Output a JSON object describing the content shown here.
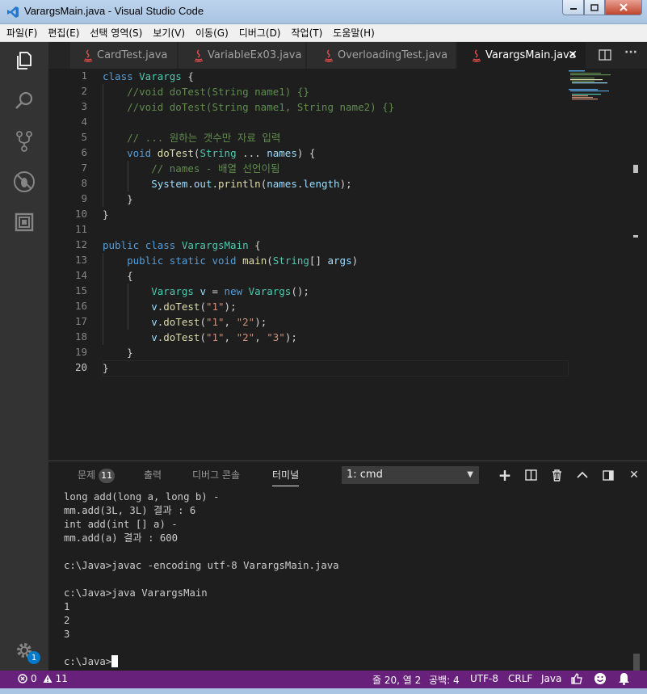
{
  "window": {
    "title": "VarargsMain.java - Visual Studio Code"
  },
  "menu": [
    "파일(F)",
    "편집(E)",
    "선택 영역(S)",
    "보기(V)",
    "이동(G)",
    "디버그(D)",
    "작업(T)",
    "도움말(H)"
  ],
  "activity_bar": {
    "icons": [
      "files-icon",
      "search-icon",
      "source-control-icon",
      "debug-icon",
      "extensions-icon"
    ],
    "settings_badge": "1"
  },
  "tabs": [
    {
      "label": "CardTest.java",
      "active": false
    },
    {
      "label": "VariableEx03.java",
      "active": false
    },
    {
      "label": "OverloadingTest.java",
      "active": false
    },
    {
      "label": "VarargsMain.java",
      "active": true
    }
  ],
  "tab_close_glyph": "✕",
  "tab_actions": {
    "more": "···"
  },
  "editor": {
    "line_numbers": [
      "1",
      "2",
      "3",
      "4",
      "5",
      "6",
      "7",
      "8",
      "9",
      "10",
      "11",
      "12",
      "13",
      "14",
      "15",
      "16",
      "17",
      "18",
      "19",
      "20"
    ],
    "current_line": "20",
    "lines": [
      [
        {
          "t": "class ",
          "c": "kw"
        },
        {
          "t": "Varargs",
          "c": "ty"
        },
        {
          "t": " {",
          "c": "pl"
        }
      ],
      [
        {
          "t": "    //void doTest(String name1) {}",
          "c": "cm"
        }
      ],
      [
        {
          "t": "    //void doTest(String name1, String name2) {}",
          "c": "cm"
        }
      ],
      [],
      [
        {
          "t": "    // ... 원하는 갯수만 자료 입력",
          "c": "cm"
        }
      ],
      [
        {
          "t": "    ",
          "c": "pl"
        },
        {
          "t": "void ",
          "c": "kw"
        },
        {
          "t": "doTest",
          "c": "fn"
        },
        {
          "t": "(",
          "c": "pl"
        },
        {
          "t": "String",
          "c": "ty"
        },
        {
          "t": " ... ",
          "c": "pl"
        },
        {
          "t": "names",
          "c": "vr"
        },
        {
          "t": ") {",
          "c": "pl"
        }
      ],
      [
        {
          "t": "        // names - 배열 선언이됨",
          "c": "cm"
        }
      ],
      [
        {
          "t": "        ",
          "c": "pl"
        },
        {
          "t": "System",
          "c": "vr"
        },
        {
          "t": ".",
          "c": "pl"
        },
        {
          "t": "out",
          "c": "vr"
        },
        {
          "t": ".",
          "c": "pl"
        },
        {
          "t": "println",
          "c": "fn"
        },
        {
          "t": "(",
          "c": "pl"
        },
        {
          "t": "names",
          "c": "vr"
        },
        {
          "t": ".",
          "c": "pl"
        },
        {
          "t": "length",
          "c": "vr"
        },
        {
          "t": ");",
          "c": "pl"
        }
      ],
      [
        {
          "t": "    }",
          "c": "pl"
        }
      ],
      [
        {
          "t": "}",
          "c": "pl"
        }
      ],
      [],
      [
        {
          "t": "public ",
          "c": "kw"
        },
        {
          "t": "class ",
          "c": "kw"
        },
        {
          "t": "VarargsMain",
          "c": "ty"
        },
        {
          "t": " {",
          "c": "pl"
        }
      ],
      [
        {
          "t": "    ",
          "c": "pl"
        },
        {
          "t": "public ",
          "c": "kw"
        },
        {
          "t": "static ",
          "c": "kw"
        },
        {
          "t": "void ",
          "c": "kw"
        },
        {
          "t": "main",
          "c": "fn"
        },
        {
          "t": "(",
          "c": "pl"
        },
        {
          "t": "String",
          "c": "ty"
        },
        {
          "t": "[] ",
          "c": "pl"
        },
        {
          "t": "args",
          "c": "vr"
        },
        {
          "t": ")",
          "c": "pl"
        }
      ],
      [
        {
          "t": "    {",
          "c": "pl"
        }
      ],
      [
        {
          "t": "        ",
          "c": "pl"
        },
        {
          "t": "Varargs",
          "c": "ty"
        },
        {
          "t": " ",
          "c": "pl"
        },
        {
          "t": "v",
          "c": "vr"
        },
        {
          "t": " = ",
          "c": "pl"
        },
        {
          "t": "new ",
          "c": "kw"
        },
        {
          "t": "Varargs",
          "c": "ty"
        },
        {
          "t": "();",
          "c": "pl"
        }
      ],
      [
        {
          "t": "        ",
          "c": "pl"
        },
        {
          "t": "v",
          "c": "vr"
        },
        {
          "t": ".",
          "c": "pl"
        },
        {
          "t": "doTest",
          "c": "fn"
        },
        {
          "t": "(",
          "c": "pl"
        },
        {
          "t": "\"1\"",
          "c": "st"
        },
        {
          "t": ");",
          "c": "pl"
        }
      ],
      [
        {
          "t": "        ",
          "c": "pl"
        },
        {
          "t": "v",
          "c": "vr"
        },
        {
          "t": ".",
          "c": "pl"
        },
        {
          "t": "doTest",
          "c": "fn"
        },
        {
          "t": "(",
          "c": "pl"
        },
        {
          "t": "\"1\"",
          "c": "st"
        },
        {
          "t": ", ",
          "c": "pl"
        },
        {
          "t": "\"2\"",
          "c": "st"
        },
        {
          "t": ");",
          "c": "pl"
        }
      ],
      [
        {
          "t": "        ",
          "c": "pl"
        },
        {
          "t": "v",
          "c": "vr"
        },
        {
          "t": ".",
          "c": "pl"
        },
        {
          "t": "doTest",
          "c": "fn"
        },
        {
          "t": "(",
          "c": "pl"
        },
        {
          "t": "\"1\"",
          "c": "st"
        },
        {
          "t": ", ",
          "c": "pl"
        },
        {
          "t": "\"2\"",
          "c": "st"
        },
        {
          "t": ", ",
          "c": "pl"
        },
        {
          "t": "\"3\"",
          "c": "st"
        },
        {
          "t": ");",
          "c": "pl"
        }
      ],
      [
        {
          "t": "    }",
          "c": "pl"
        }
      ],
      [
        {
          "t": "}",
          "c": "pl"
        }
      ]
    ]
  },
  "panel": {
    "tabs": [
      {
        "label": "문제",
        "badge": "11"
      },
      {
        "label": "출력"
      },
      {
        "label": "디버그 콘솔"
      },
      {
        "label": "터미널",
        "active": true
      }
    ],
    "terminal_select": "1: cmd",
    "actions": {
      "add": "+",
      "close": "✕"
    },
    "terminal_lines": [
      "long add(long a, long b) -",
      "mm.add(3L, 3L) 결과 : 6",
      "int add(int [] a) -",
      "mm.add(a) 결과 : 600",
      "",
      "c:\\Java>javac -encoding utf-8 VarargsMain.java",
      "",
      "c:\\Java>java VarargsMain",
      "1",
      "2",
      "3",
      "",
      "c:\\Java>"
    ]
  },
  "statusbar": {
    "errors": "0",
    "warnings": "11",
    "position": "줄 20, 열 2",
    "spaces": "공백: 4",
    "encoding": "UTF-8",
    "eol": "CRLF",
    "language": "Java"
  },
  "colors": {
    "statusbar": "#68217a",
    "editor_bg": "#1e1e1e",
    "activity_bg": "#333333",
    "accent": "#007acc"
  }
}
